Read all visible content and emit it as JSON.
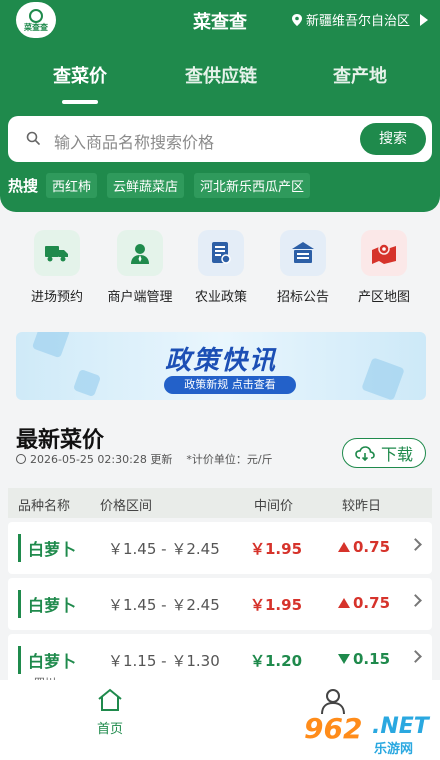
{
  "header": {
    "logo_text": "菜查查",
    "title": "菜查查",
    "location": "新疆维吾尔自治区"
  },
  "tabs": [
    {
      "label": "查菜价",
      "active": true
    },
    {
      "label": "查供应链",
      "active": false
    },
    {
      "label": "查产地",
      "active": false
    }
  ],
  "search": {
    "placeholder": "输入商品名称搜索价格",
    "button": "搜索"
  },
  "hot": {
    "label": "热搜",
    "chips": [
      "西红柿",
      "云鲜蔬菜店",
      "河北新乐西瓜产区"
    ]
  },
  "menu": [
    {
      "label": "进场预约",
      "icon": "truck-icon"
    },
    {
      "label": "商户端管理",
      "icon": "merchant-icon"
    },
    {
      "label": "农业政策",
      "icon": "policy-doc-icon"
    },
    {
      "label": "招标公告",
      "icon": "announcement-icon"
    },
    {
      "label": "产区地图",
      "icon": "map-icon"
    }
  ],
  "banner": {
    "title": "政策快讯",
    "subtitle": "政策新规 点击查看"
  },
  "prices": {
    "title": "最新菜价",
    "updated": "2026-05-25 02:30:28 更新",
    "unit": "*计价单位：元/斤",
    "download": "下载",
    "columns": [
      "品种名称",
      "价格区间",
      "中间价",
      "较昨日"
    ],
    "rows": [
      {
        "name": "白萝卜",
        "range": "￥1.45 - ￥2.45",
        "mid": "￥1.95",
        "change": "0.75",
        "dir": "up"
      },
      {
        "name": "白萝卜",
        "range": "￥1.45 - ￥2.45",
        "mid": "￥1.95",
        "change": "0.75",
        "dir": "up"
      },
      {
        "name": "白萝卜",
        "range": "￥1.15 - ￥1.30",
        "mid": "￥1.20",
        "change": "0.15",
        "dir": "down",
        "sub": "四川"
      }
    ]
  },
  "nav": {
    "home": "首页"
  },
  "watermark": {
    "num": "962",
    "net": ".NET",
    "cn": "乐游网"
  },
  "colors": {
    "brand": "#1f8a4c",
    "up": "#d6332b",
    "down": "#1f8a4c"
  }
}
